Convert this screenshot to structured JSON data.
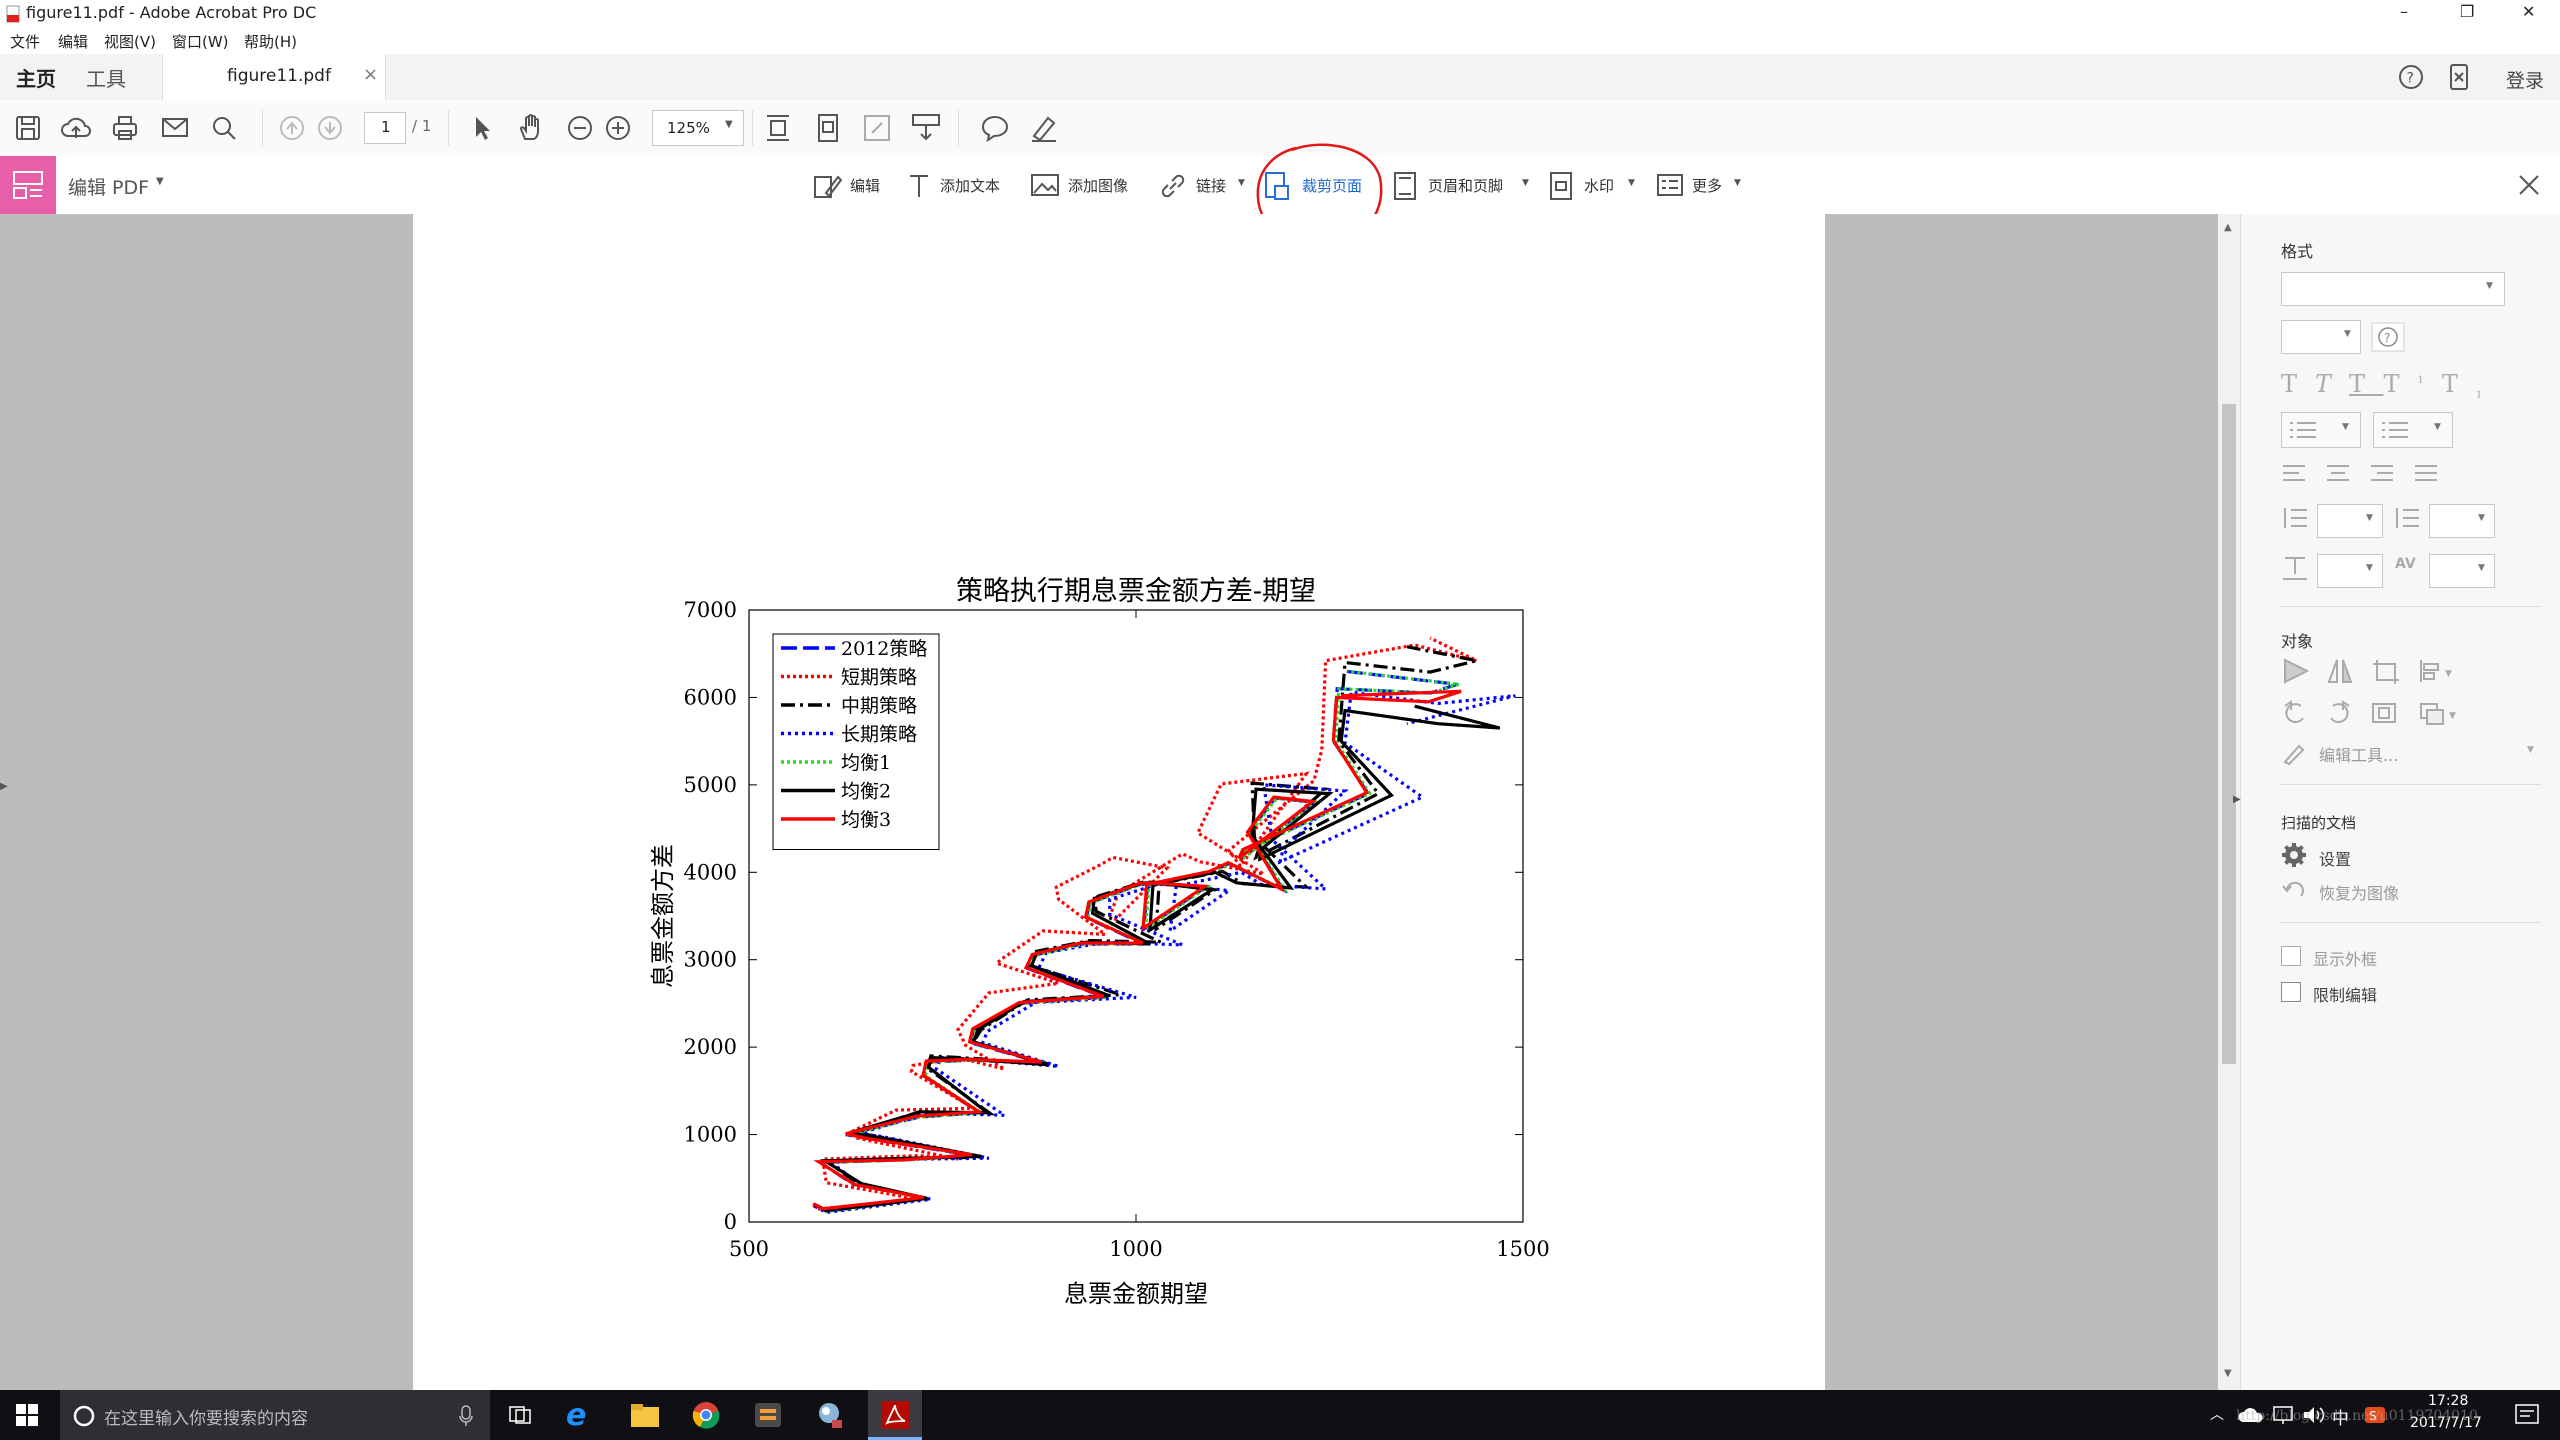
{
  "window": {
    "title": "figure11.pdf - Adobe Acrobat Pro DC",
    "controls": [
      "–",
      "❐",
      "✕"
    ]
  },
  "menu": [
    "文件",
    "编辑",
    "视图(V)",
    "窗口(W)",
    "帮助(H)"
  ],
  "tabs": {
    "home": "主页",
    "tools": "工具",
    "doc": "figure11.pdf",
    "close": "×",
    "login": "登录"
  },
  "toolbar": {
    "page_current": "1",
    "page_total": "/ 1",
    "zoom": "125%"
  },
  "edit_toolbar": {
    "label": "编辑 PDF",
    "items": [
      "编辑",
      "添加文本",
      "添加图像",
      "链接",
      "裁剪页面",
      "页眉和页脚",
      "水印",
      "更多"
    ]
  },
  "right_panel": {
    "format_header": "格式",
    "object_header": "对象",
    "edit_tool": "编辑工具...",
    "scanned_header": "扫描的文档",
    "settings": "设置",
    "restore": "恢复为图像",
    "show_box": "显示外框",
    "restrict_edit": "限制编辑"
  },
  "taskbar": {
    "search_placeholder": "在这里输入你要搜索的内容",
    "time": "17:28",
    "date": "2017/7/17",
    "ime": "中",
    "watermark": "http://blog.csdn.net/u0119704010"
  },
  "chart_data": {
    "type": "line",
    "title": "策略执行期息票金额方差-期望",
    "xlabel": "息票金额期望",
    "ylabel": "息票金额方差",
    "xlim": [
      500,
      1500
    ],
    "ylim": [
      0,
      7000
    ],
    "xticks": [
      "500",
      "1000",
      "1500"
    ],
    "yticks": [
      "0",
      "1000",
      "2000",
      "3000",
      "4000",
      "5000",
      "6000",
      "7000"
    ],
    "legend_position": "top-left",
    "grid": false,
    "series": [
      {
        "name": "2012策略",
        "color": "#0000ff",
        "dash": "16,6",
        "x": [
          585,
          600,
          730,
          635,
          592,
          700,
          790,
          650,
          625,
          720,
          798,
          726,
          730,
          786,
          880,
          786,
          790,
          850,
          960,
          860,
          868,
          930,
          1010,
          936,
          940,
          1004,
          1020,
          1090,
          1010,
          1015,
          1096,
          1120,
          1190,
          1145,
          1180,
          1230,
          1135,
          1140,
          1300,
          1255,
          1260,
          1380,
          1415,
          1270
        ],
        "y": [
          200,
          120,
          270,
          430,
          680,
          710,
          760,
          960,
          1000,
          1200,
          1250,
          1670,
          1830,
          1850,
          1820,
          2050,
          2200,
          2500,
          2570,
          2900,
          3050,
          3180,
          3180,
          3480,
          3650,
          3860,
          3870,
          3830,
          3350,
          3850,
          4000,
          4100,
          3800,
          4450,
          4850,
          4800,
          4150,
          4250,
          4900,
          5500,
          6100,
          6050,
          6150,
          6300
        ]
      },
      {
        "name": "短期策略",
        "color": "#ff0000",
        "dash": "3,3",
        "x": [
          583,
          590,
          720,
          600,
          595,
          720,
          770,
          640,
          632,
          690,
          790,
          710,
          712,
          770,
          830,
          780,
          770,
          810,
          900,
          820,
          830,
          880,
          960,
          900,
          897,
          955,
          970,
          1040,
          960,
          977,
          1060,
          1083,
          1165,
          1080,
          1110,
          1220,
          1135,
          1120,
          1230,
          1240,
          1245,
          1360,
          1440,
          1380
        ],
        "y": [
          190,
          150,
          260,
          450,
          720,
          760,
          720,
          960,
          1030,
          1280,
          1300,
          1720,
          1790,
          1880,
          1750,
          2020,
          2200,
          2620,
          2730,
          2960,
          3030,
          3330,
          3290,
          3690,
          3830,
          4090,
          4170,
          4050,
          3340,
          3760,
          4210,
          4120,
          3980,
          4450,
          5010,
          5130,
          4070,
          4250,
          5050,
          5400,
          6420,
          6600,
          6420,
          6680
        ]
      },
      {
        "name": "中期策略",
        "color": "#000000",
        "dash": "14,5,3,5",
        "x": [
          585,
          600,
          730,
          640,
          600,
          710,
          800,
          660,
          635,
          720,
          812,
          730,
          735,
          793,
          890,
          790,
          800,
          860,
          980,
          862,
          868,
          940,
          1032,
          949,
          945,
          1010,
          1034,
          1102,
          1026,
          1030,
          1112,
          1138,
          1220,
          1153,
          1150,
          1245,
          1160,
          1155,
          1313,
          1262,
          1270,
          1380,
          1440,
          1350
        ],
        "y": [
          200,
          130,
          270,
          440,
          700,
          730,
          740,
          990,
          1020,
          1260,
          1240,
          1760,
          1900,
          1870,
          1800,
          2060,
          2200,
          2540,
          2600,
          2940,
          3090,
          3220,
          3200,
          3550,
          3710,
          3890,
          3880,
          3800,
          3350,
          3870,
          4010,
          3870,
          3830,
          4400,
          5020,
          4950,
          4300,
          4170,
          4900,
          5500,
          6400,
          6290,
          6420,
          6580
        ]
      },
      {
        "name": "长期策略",
        "color": "#0000ff",
        "dash": "3,4",
        "x": [
          585,
          600,
          735,
          645,
          605,
          718,
          810,
          670,
          642,
          730,
          830,
          742,
          748,
          806,
          900,
          802,
          808,
          870,
          1000,
          874,
          884,
          960,
          1060,
          966,
          966,
          1030,
          1044,
          1120,
          1044,
          1052,
          1136,
          1162,
          1245,
          1176,
          1165,
          1270,
          1190,
          1186,
          1370,
          1270,
          1278,
          1390,
          1490,
          1350
        ],
        "y": [
          180,
          110,
          260,
          420,
          690,
          720,
          730,
          980,
          1010,
          1250,
          1220,
          1750,
          1880,
          1850,
          1780,
          2050,
          2180,
          2510,
          2570,
          2900,
          3080,
          3200,
          3170,
          3520,
          3690,
          3870,
          3860,
          3790,
          3330,
          3840,
          4000,
          3860,
          3810,
          4370,
          5000,
          4930,
          4260,
          4120,
          4860,
          5480,
          6060,
          5930,
          6020,
          5700
        ]
      },
      {
        "name": "均衡1",
        "color": "#22dd22",
        "dash": "3,3",
        "x": [
          585,
          600,
          728,
          637,
          592,
          702,
          792,
          652,
          627,
          720,
          800,
          728,
          732,
          788,
          882,
          788,
          792,
          852,
          962,
          862,
          870,
          932,
          1012,
          938,
          942,
          1006,
          1022,
          1092,
          1012,
          1017,
          1098,
          1122,
          1192,
          1147,
          1182,
          1232,
          1137,
          1142,
          1302,
          1258,
          1262,
          1382,
          1417,
          1273
        ],
        "y": [
          200,
          120,
          270,
          430,
          680,
          710,
          760,
          960,
          1000,
          1200,
          1250,
          1670,
          1830,
          1850,
          1820,
          2050,
          2200,
          2500,
          2570,
          2900,
          3050,
          3180,
          3180,
          3480,
          3650,
          3860,
          3870,
          3830,
          3350,
          3850,
          4000,
          4100,
          3800,
          4450,
          4850,
          4800,
          4150,
          4250,
          4900,
          5500,
          6100,
          6050,
          6150,
          6300
        ]
      },
      {
        "name": "均衡2",
        "color": "#000000",
        "dash": "",
        "x": [
          585,
          600,
          730,
          645,
          598,
          712,
          800,
          660,
          630,
          722,
          808,
          732,
          736,
          790,
          885,
          790,
          796,
          855,
          965,
          865,
          872,
          935,
          1018,
          944,
          946,
          1010,
          1025,
          1098,
          1018,
          1022,
          1102,
          1130,
          1200,
          1150,
          1155,
          1250,
          1160,
          1160,
          1330,
          1265,
          1270,
          1390,
          1470,
          1360
        ],
        "y": [
          200,
          130,
          270,
          440,
          700,
          730,
          750,
          980,
          1020,
          1260,
          1250,
          1770,
          1880,
          1860,
          1800,
          2060,
          2200,
          2520,
          2590,
          2930,
          3080,
          3200,
          3180,
          3530,
          3700,
          3880,
          3880,
          3800,
          3340,
          3860,
          4000,
          3880,
          3820,
          4420,
          4950,
          4900,
          4250,
          4150,
          4880,
          5500,
          5850,
          5700,
          5650,
          5900
        ]
      },
      {
        "name": "均衡3",
        "color": "#ff0000",
        "dash": "",
        "x": [
          583,
          595,
          726,
          636,
          590,
          700,
          788,
          650,
          625,
          717,
          797,
          725,
          729,
          785,
          878,
          785,
          789,
          849,
          958,
          858,
          866,
          928,
          1009,
          935,
          939,
          1003,
          1019,
          1089,
          1009,
          1014,
          1095,
          1119,
          1188,
          1144,
          1178,
          1228,
          1133,
          1138,
          1298,
          1255,
          1259,
          1378,
          1420,
          1265
        ],
        "y": [
          210,
          150,
          280,
          430,
          690,
          710,
          770,
          960,
          1010,
          1210,
          1260,
          1680,
          1840,
          1860,
          1830,
          2060,
          2210,
          2510,
          2580,
          2910,
          3060,
          3190,
          3190,
          3490,
          3660,
          3870,
          3880,
          3840,
          3360,
          3860,
          4010,
          4110,
          3810,
          4460,
          4860,
          4810,
          4160,
          4260,
          4910,
          5510,
          6000,
          5950,
          6070,
          6020
        ]
      }
    ]
  }
}
